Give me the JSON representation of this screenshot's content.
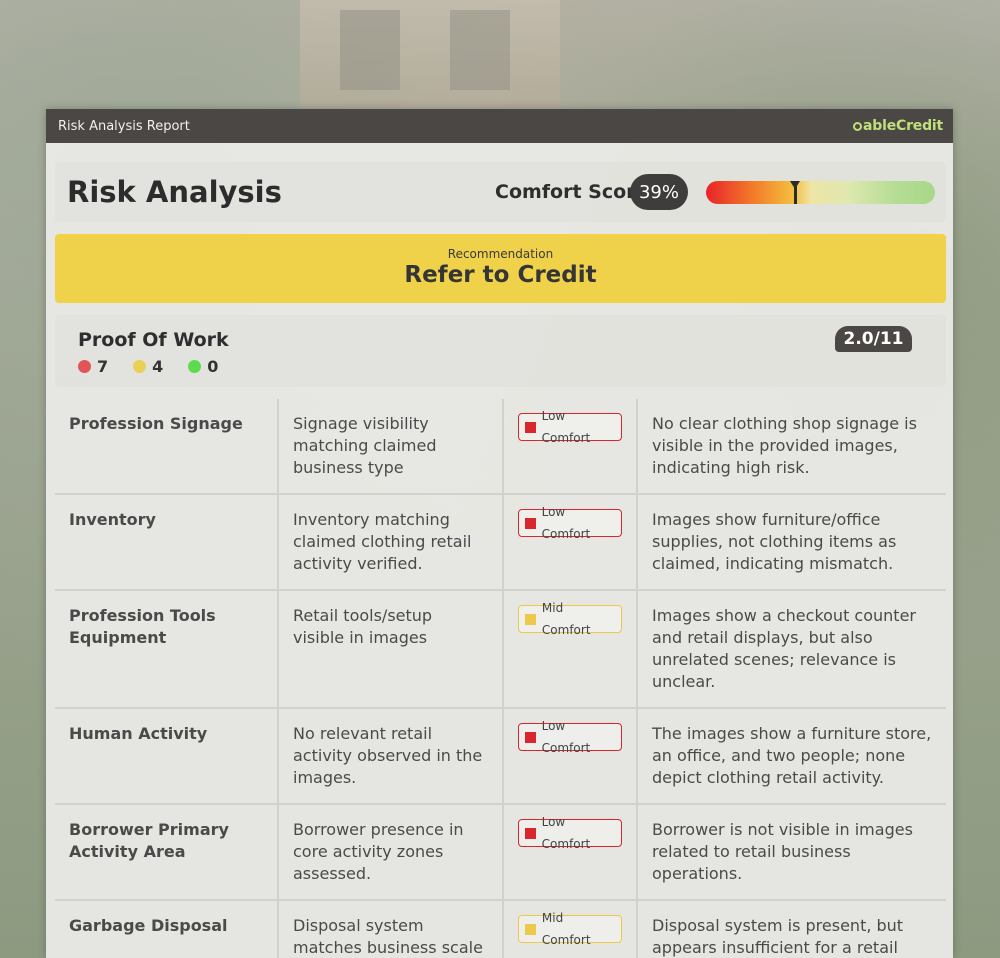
{
  "report": {
    "title": "Risk Analysis Report",
    "brand": "ableCredit"
  },
  "header": {
    "title": "Risk Analysis",
    "comfort_score_label": "Comfort Score",
    "comfort_score_value": "39%",
    "comfort_score_fraction": 0.39
  },
  "recommendation": {
    "label": "Recommendation",
    "value": "Refer to Credit"
  },
  "proof_of_work": {
    "title": "Proof Of Work",
    "counts": {
      "red": "7",
      "yellow": "4",
      "green": "0"
    },
    "score": "2.0/11"
  },
  "colors": {
    "low": "#d8272d",
    "mid": "#ecc94b",
    "green": "#5ddb4f",
    "reco_bg": "#efd24a",
    "dark": "#4a4745"
  },
  "criteria": [
    {
      "name": "Profession Signage",
      "description": "Signage visibility matching claimed business type",
      "comfort": "Low Comfort",
      "level": "low",
      "note": "No clear clothing shop signage is visible in the provided images, indicating high risk."
    },
    {
      "name": "Inventory",
      "description": "Inventory matching claimed clothing retail activity verified.",
      "comfort": "Low Comfort",
      "level": "low",
      "note": "Images show furniture/office supplies, not clothing items as claimed, indicating mismatch."
    },
    {
      "name": "Profession Tools Equipment",
      "description": "Retail tools/setup visible in images",
      "comfort": "Mid Comfort",
      "level": "mid",
      "note": "Images show a checkout counter and retail displays, but also unrelated scenes; relevance is unclear."
    },
    {
      "name": "Human Activity",
      "description": "No relevant retail activity observed in the images.",
      "comfort": "Low Comfort",
      "level": "low",
      "note": "The images show a furniture store, an office, and two people; none depict clothing retail activity."
    },
    {
      "name": "Borrower Primary Activity Area",
      "description": "Borrower presence in core activity zones assessed.",
      "comfort": "Low Comfort",
      "level": "low",
      "note": "Borrower is not visible in images related to retail business operations."
    },
    {
      "name": "Garbage Disposal",
      "description": "Disposal system matches business scale and type.",
      "comfort": "Mid Comfort",
      "level": "mid",
      "note": "Disposal system is present, but appears insufficient for a retail"
    }
  ]
}
